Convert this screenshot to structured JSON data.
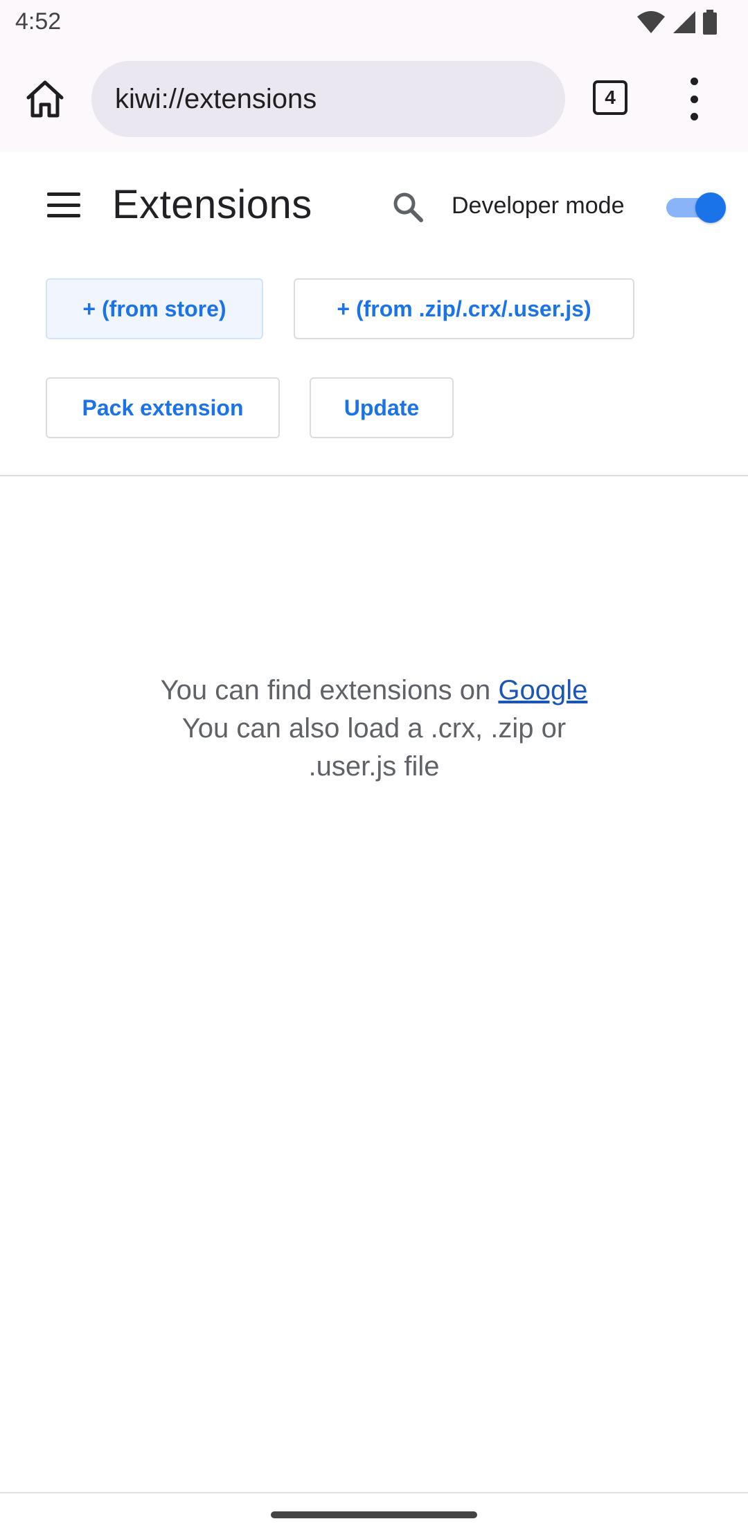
{
  "status_bar": {
    "time": "4:52",
    "icons": [
      "wifi-icon",
      "signal-icon",
      "battery-icon"
    ]
  },
  "browser": {
    "url": "kiwi://extensions",
    "tab_count": "4"
  },
  "header": {
    "title": "Extensions",
    "developer_mode_label": "Developer mode",
    "developer_mode_enabled": true
  },
  "actions": {
    "from_store": "+ (from store)",
    "from_file": "+ (from .zip/.crx/.user.js)",
    "pack": "Pack extension",
    "update": "Update"
  },
  "empty_state": {
    "line1_prefix": "You can find extensions on ",
    "line1_link": "Google",
    "line2": "You can also load a .crx, .zip or",
    "line3": ".user.js file"
  },
  "colors": {
    "accent": "#1a73e8",
    "toggle_track": "#8ab4f8",
    "toolbar_bg": "#fcf8fc",
    "omnibox_bg": "#ebe7f1"
  }
}
